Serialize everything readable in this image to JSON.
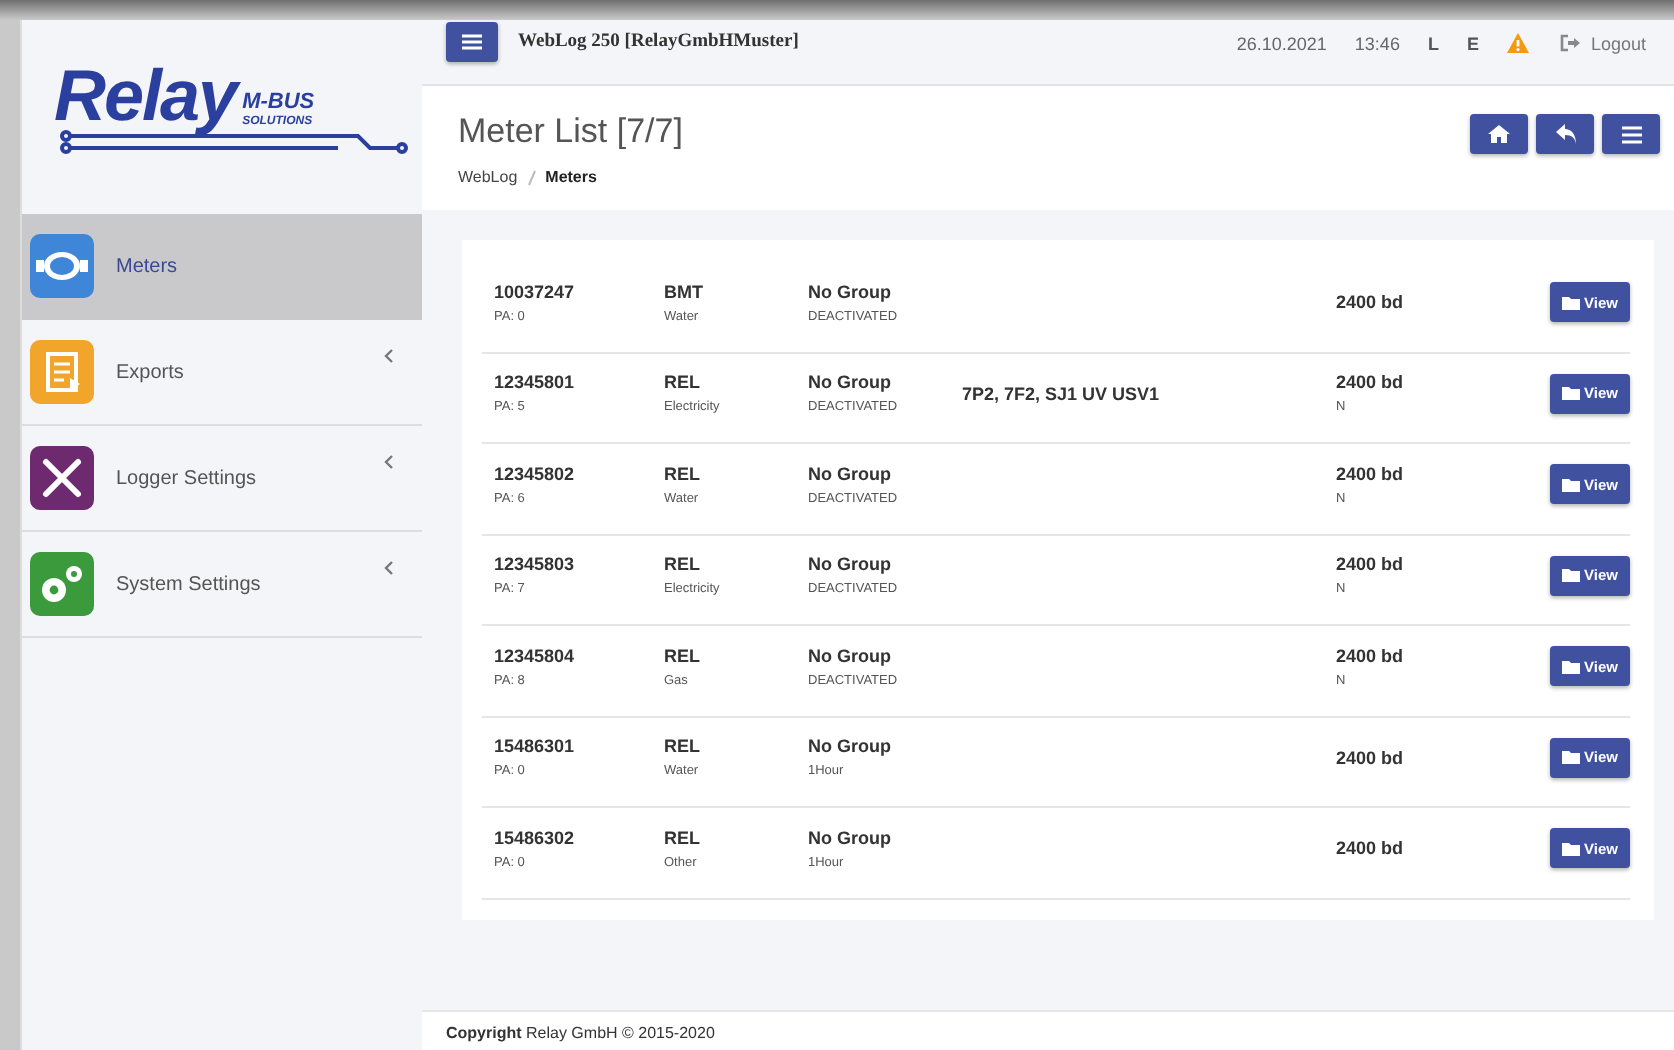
{
  "logo": {
    "brand": "Relay",
    "line_1": "M-BUS",
    "line_2": "SOLUTIONS"
  },
  "topbar": {
    "title": "WebLog 250 [RelayGmbHMuster]",
    "date": "26.10.2021",
    "time": "13:46",
    "indicators": [
      "L",
      "E"
    ],
    "logout": "Logout"
  },
  "sidebar": {
    "items": [
      {
        "label": "Meters",
        "kind": "meter",
        "selected": true,
        "expandable": false
      },
      {
        "label": "Exports",
        "kind": "export",
        "selected": false,
        "expandable": true
      },
      {
        "label": "Logger Settings",
        "kind": "tools",
        "selected": false,
        "expandable": true
      },
      {
        "label": "System Settings",
        "kind": "gears",
        "selected": false,
        "expandable": true
      }
    ]
  },
  "page": {
    "title": "Meter List [7/7]",
    "breadcrumb": [
      {
        "label": "WebLog",
        "current": false
      },
      {
        "label": "Meters",
        "current": true
      }
    ]
  },
  "meters": [
    {
      "id": "10037247",
      "address": "PA: 0",
      "manufacturer": "BMT",
      "medium": "Water",
      "group": "No Group",
      "status": "DEACTIVATED",
      "baud": "2400 bd",
      "button": "View"
    },
    {
      "id": "12345801",
      "address": "PA: 5",
      "manufacturer": "REL",
      "medium": "Electricity",
      "group": "No Group",
      "status": "DEACTIVATED",
      "notes": "7P2, 7F2, SJ1 UV USV1",
      "baud": "2400 bd",
      "parity": "N",
      "button": "View"
    },
    {
      "id": "12345802",
      "address": "PA: 6",
      "manufacturer": "REL",
      "medium": "Water",
      "group": "No Group",
      "status": "DEACTIVATED",
      "baud": "2400 bd",
      "parity": "N",
      "button": "View"
    },
    {
      "id": "12345803",
      "address": "PA: 7",
      "manufacturer": "REL",
      "medium": "Electricity",
      "group": "No Group",
      "status": "DEACTIVATED",
      "baud": "2400 bd",
      "parity": "N",
      "button": "View"
    },
    {
      "id": "12345804",
      "address": "PA: 8",
      "manufacturer": "REL",
      "medium": "Gas",
      "group": "No Group",
      "status": "DEACTIVATED",
      "baud": "2400 bd",
      "parity": "N",
      "button": "View"
    },
    {
      "id": "15486301",
      "address": "PA: 0",
      "manufacturer": "REL",
      "medium": "Water",
      "group": "No Group",
      "status": "1Hour",
      "baud": "2400 bd",
      "button": "View"
    },
    {
      "id": "15486302",
      "address": "PA: 0",
      "manufacturer": "REL",
      "medium": "Other",
      "group": "No Group",
      "status": "1Hour",
      "baud": "2400 bd",
      "button": "View"
    }
  ],
  "footer": {
    "copyright": "**Copyright** Relay GmbH © 2015-2020"
  }
}
